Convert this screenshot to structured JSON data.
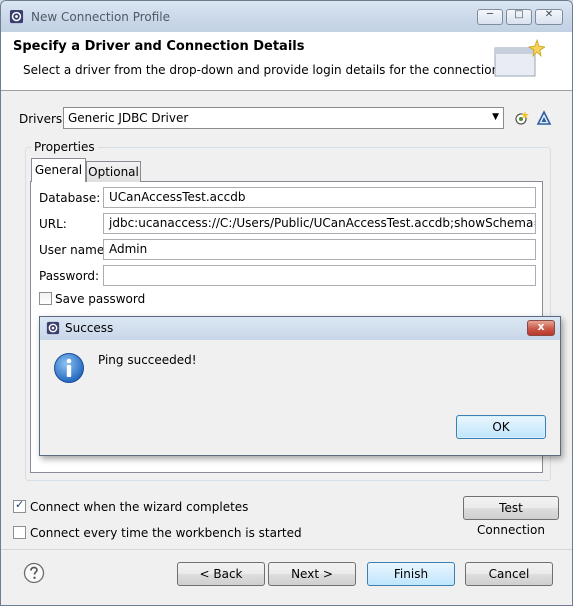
{
  "window": {
    "title": "New Connection Profile",
    "minimize_glyph": "─",
    "maximize_glyph": "□",
    "close_glyph": "✕"
  },
  "header": {
    "title": "Specify a Driver and Connection Details",
    "description": "Select a driver from the drop-down and provide login details for the connection."
  },
  "drivers": {
    "label": "Drivers:",
    "selected": "Generic JDBC Driver",
    "new_icon": "new-driver-icon",
    "edit_icon": "edit-driver-icon"
  },
  "properties": {
    "group_label": "Properties",
    "tabs": [
      {
        "label": "General",
        "active": true
      },
      {
        "label": "Optional",
        "active": false
      }
    ],
    "fields": {
      "database": {
        "label": "Database:",
        "value": "UCanAccessTest.accdb"
      },
      "url": {
        "label": "URL:",
        "value": "jdbc:ucanaccess://C:/Users/Public/UCanAccessTest.accdb;showSchema=true"
      },
      "username": {
        "label": "User name:",
        "value": "Admin"
      },
      "password": {
        "label": "Password:",
        "value": ""
      }
    },
    "save_password": {
      "label": "Save password",
      "checked": false
    }
  },
  "dialog": {
    "title": "Success",
    "message": "Ping succeeded!",
    "ok_label": "OK",
    "close_glyph": "x",
    "icon": "info-icon"
  },
  "options": {
    "connect_when_complete": {
      "label": "Connect when the wizard completes",
      "checked": true
    },
    "connect_every_time": {
      "label": "Connect every time the workbench is started",
      "checked": false
    },
    "test_connection_label": "Test Connection"
  },
  "footer": {
    "back_label": "< Back",
    "next_label": "Next >",
    "finish_label": "Finish",
    "cancel_label": "Cancel",
    "help_icon": "help-icon"
  },
  "colors": {
    "title_bar": "#c9d7e8",
    "dialog_background": "#f0f0f0",
    "default_button": "#bee6fd",
    "close_button": "#c9584a",
    "info_icon": "#2a6fc9"
  }
}
